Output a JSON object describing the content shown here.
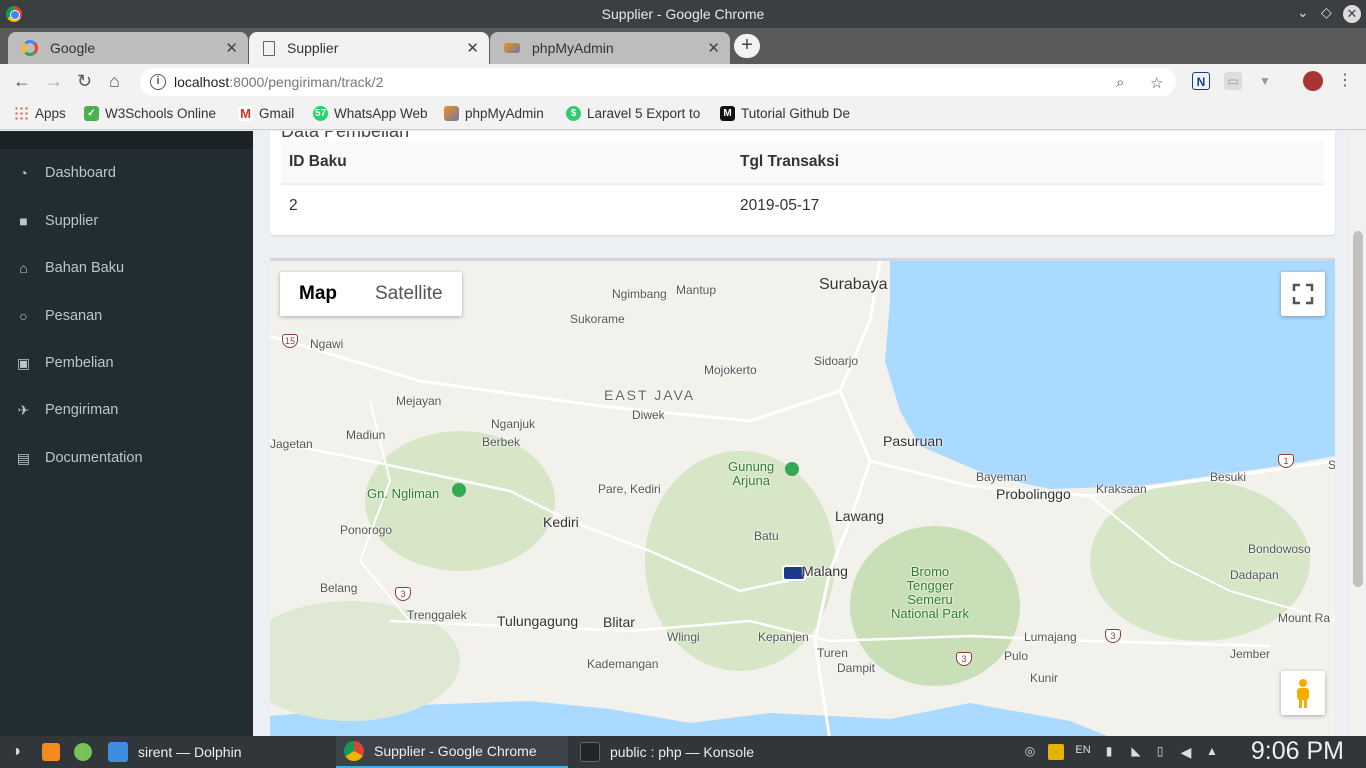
{
  "window": {
    "title": "Supplier - Google Chrome"
  },
  "tabs": [
    {
      "label": "Google",
      "icon": "google-icon"
    },
    {
      "label": "Supplier",
      "icon": "page-icon"
    },
    {
      "label": "phpMyAdmin",
      "icon": "phpmyadmin-icon"
    }
  ],
  "address": {
    "host": "localhost",
    "path": ":8000/pengiriman/track/2"
  },
  "bookmarks": [
    {
      "label": "Apps",
      "icon": "apps-grid-icon",
      "color": "#e2574c"
    },
    {
      "label": "W3Schools Online",
      "icon": "w3schools-icon",
      "color": "#4caf50"
    },
    {
      "label": "Gmail",
      "icon": "gmail-icon",
      "color": "#d93025"
    },
    {
      "label": "WhatsApp Web",
      "icon": "whatsapp-icon",
      "color": "#25d366"
    },
    {
      "label": "phpMyAdmin",
      "icon": "phpmyadmin-icon",
      "color": "#f29111"
    },
    {
      "label": "Laravel 5 Export to",
      "icon": "laravel-icon",
      "color": "#2ecc71"
    },
    {
      "label": "Tutorial Github De",
      "icon": "medium-icon",
      "color": "#111111"
    }
  ],
  "sidebar": {
    "items": [
      {
        "label": "Dashboard",
        "icon": "dashboard-icon"
      },
      {
        "label": "Supplier",
        "icon": "truck-icon"
      },
      {
        "label": "Bahan Baku",
        "icon": "bank-icon"
      },
      {
        "label": "Pesanan",
        "icon": "comment-icon"
      },
      {
        "label": "Pembelian",
        "icon": "money-icon"
      },
      {
        "label": "Pengiriman",
        "icon": "plane-icon"
      },
      {
        "label": "Documentation",
        "icon": "book-icon"
      }
    ]
  },
  "purchase": {
    "title": "Data Pembelian",
    "columns": [
      "ID Baku",
      "Tgl Transaksi"
    ],
    "rows": [
      [
        "2",
        "2019-05-17"
      ]
    ]
  },
  "map": {
    "type_buttons": [
      "Map",
      "Satellite"
    ],
    "selected_type": "Map",
    "labels": {
      "surabaya": "Surabaya",
      "ngimbang": "Ngimbang",
      "mantup": "Mantup",
      "sukorame": "Sukorame",
      "ngawi": "Ngawi",
      "sidoarjo": "Sidoarjo",
      "mojokerto": "Mojokerto",
      "east_java": "EAST JAVA",
      "mejayan": "Mejayan",
      "diwek": "Diwek",
      "nganjuk": "Nganjuk",
      "berbek": "Berbek",
      "madiun": "Madiun",
      "jagetan": "Jagetan",
      "pasuruan": "Pasuruan",
      "gunung_arjuna": "Gunung\nArjuna",
      "bayeman": "Bayeman",
      "besuki": "Besuki",
      "probolinggo": "Probolinggo",
      "kraksaan": "Kraksaan",
      "gn_ngliman": "Gn. Ngliman",
      "pare_kediri": "Pare, Kediri",
      "kediri": "Kediri",
      "lawang": "Lawang",
      "ponorogo": "Ponorogo",
      "batu": "Batu",
      "bondowoso": "Bondowoso",
      "malang": "Malang",
      "bromo": "Bromo\nTengger\nSemeru\nNational Park",
      "dadapan": "Dadapan",
      "belang": "Belang",
      "trenggalek": "Trenggalek",
      "tulungagung": "Tulungagung",
      "blitar": "Blitar",
      "mount_ra": "Mount Ra",
      "wlingi": "Wlingi",
      "kepanjen": "Kepanjen",
      "lumajang": "Lumajang",
      "kademangan": "Kademangan",
      "turen": "Turen",
      "pulo": "Pulo",
      "jember": "Jember",
      "dampit": "Dampit",
      "kunir": "Kunir",
      "s": "S"
    },
    "route_shields": [
      "15",
      "3",
      "3",
      "3",
      "1"
    ]
  },
  "taskbar": {
    "items": [
      {
        "label": "sirent — Dolphin",
        "icon": "dolphin-icon"
      },
      {
        "label": "Supplier - Google Chrome",
        "icon": "chrome-icon"
      },
      {
        "label": "public : php — Konsole",
        "icon": "konsole-icon"
      }
    ],
    "tray_lang": "EN",
    "clock": "9:06 PM"
  },
  "colors": {
    "sidebar_bg": "#222d32",
    "water": "#aadaff",
    "land": "#f3f1ec",
    "park": "#c8dfb7"
  }
}
